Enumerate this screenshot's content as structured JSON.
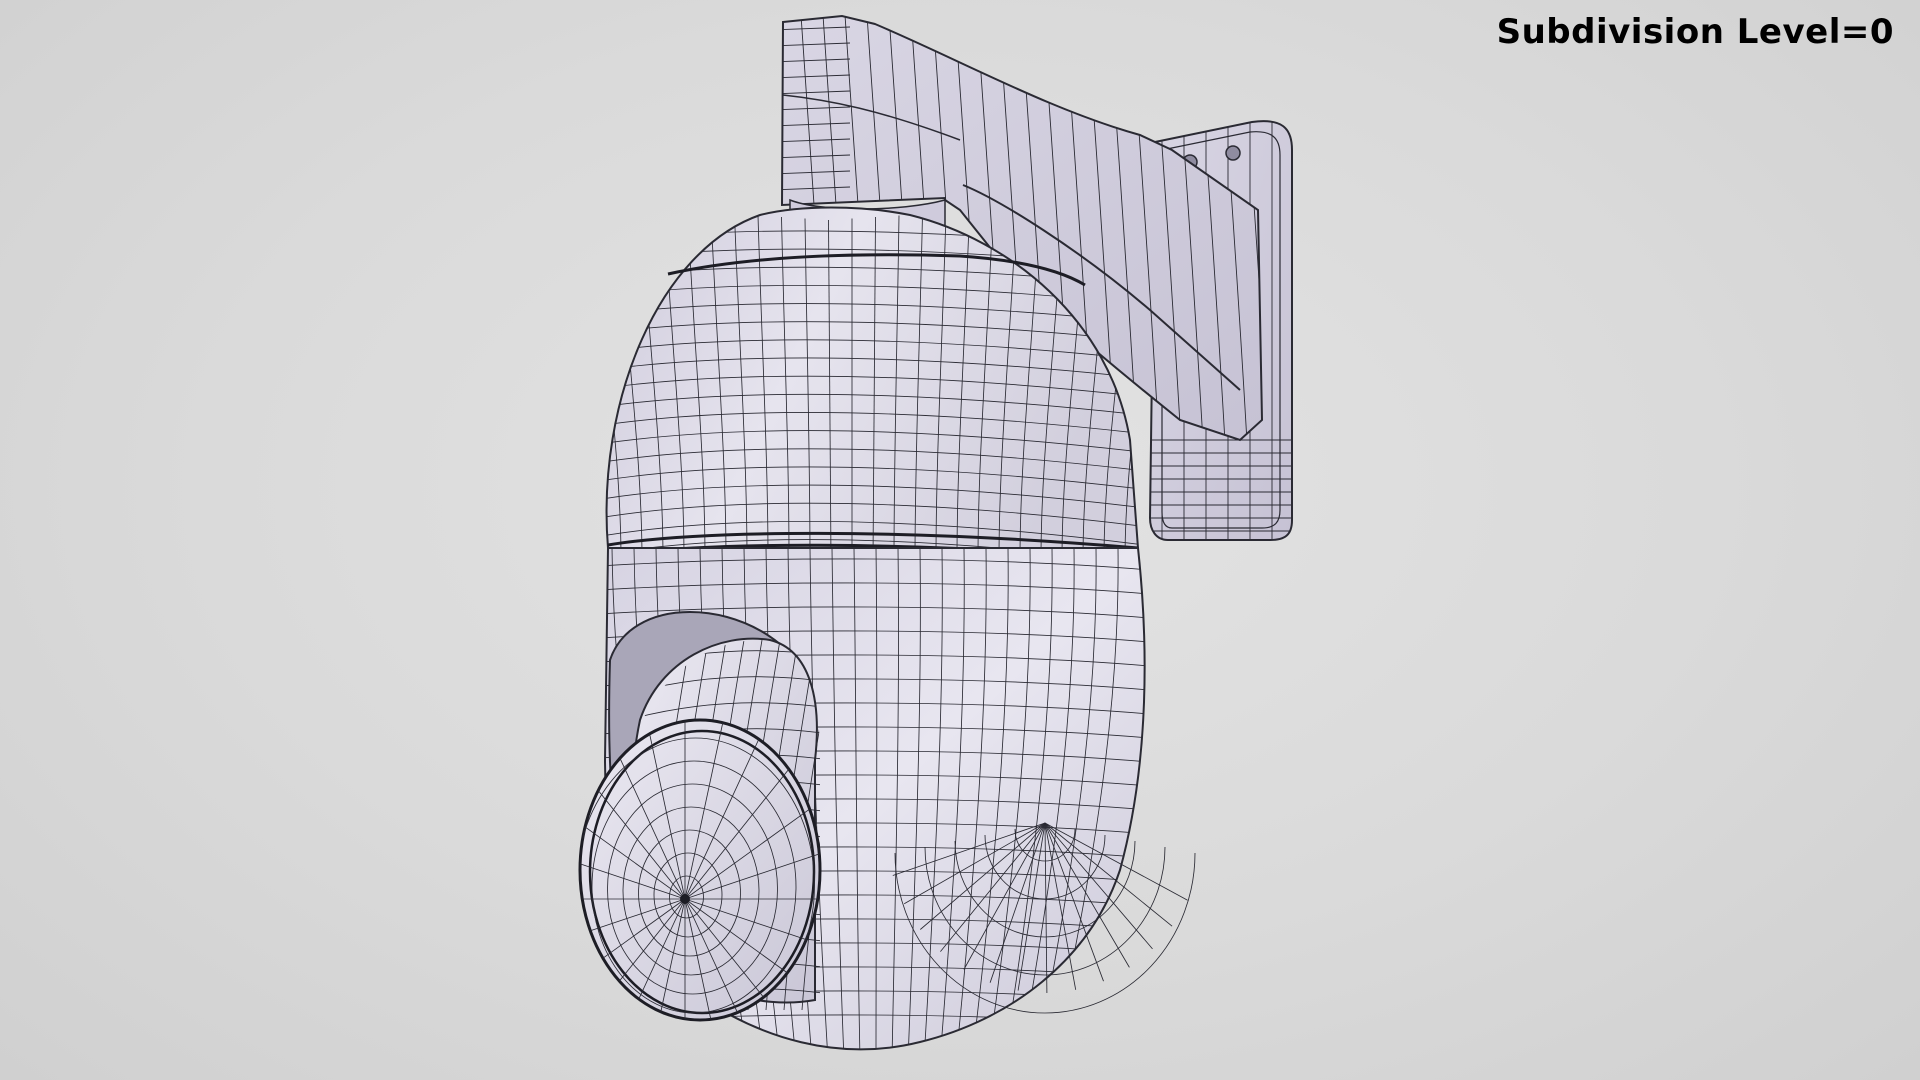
{
  "overlay": {
    "label": "Subdivision Level=0"
  },
  "colors": {
    "background": "#d9d9d9",
    "model_fill": "#e4e2ec",
    "model_shade": "#b9b6c6",
    "wire": "#2a2a33",
    "label": "#000000"
  },
  "scene": {
    "subject": "ptz-dome-camera-with-wall-mount-bracket",
    "render_mode": "wireframe-on-shaded"
  }
}
